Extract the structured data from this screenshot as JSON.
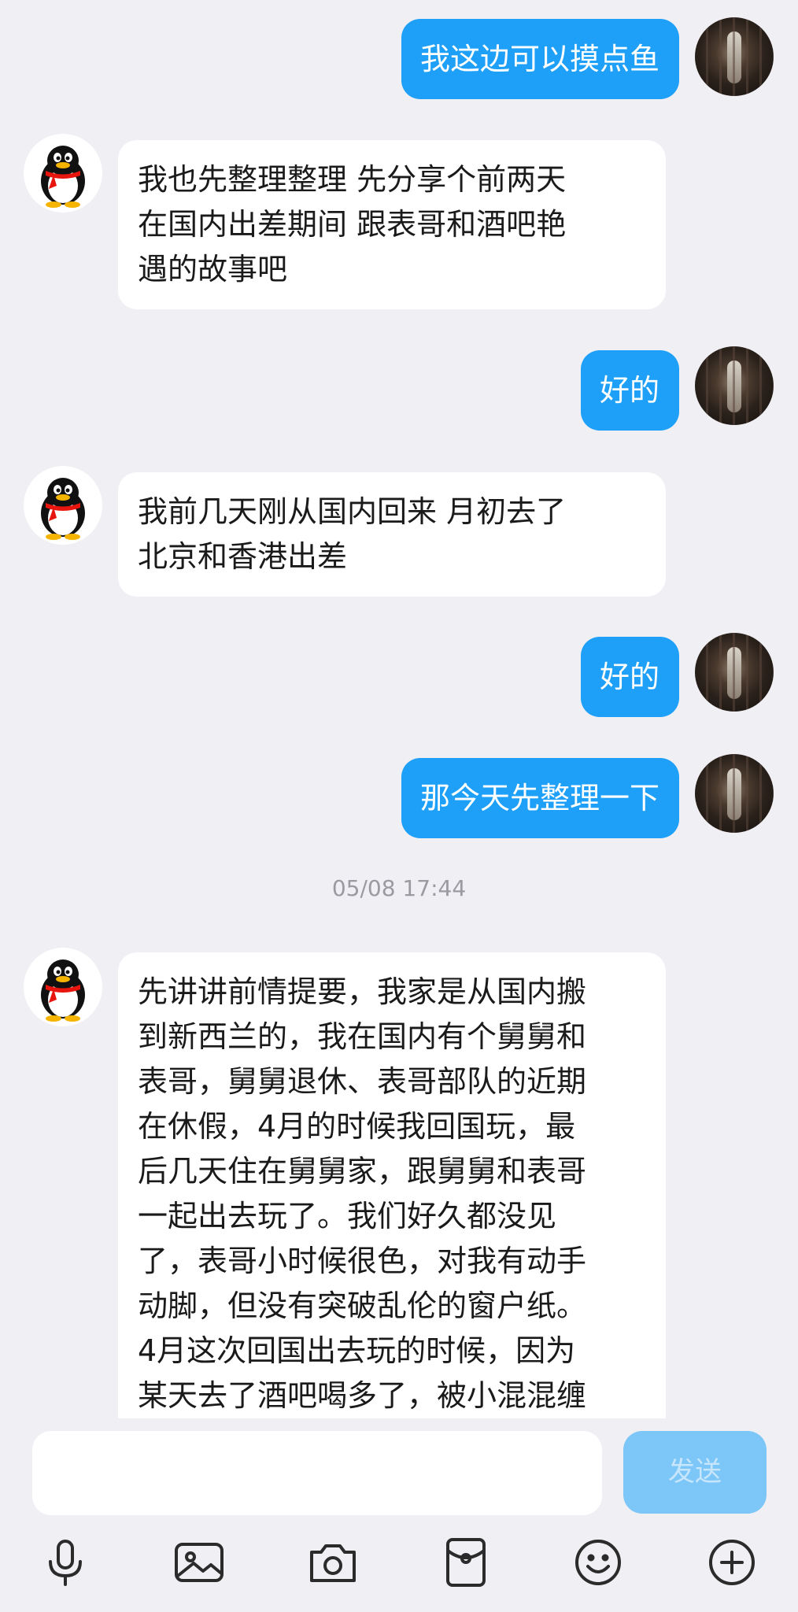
{
  "messages": [
    {
      "side": "me",
      "text": "我这边可以摸点鱼"
    },
    {
      "side": "other",
      "lines": [
        "我也先整理整理 先分享个前两天",
        "在国内出差期间 跟表哥和酒吧艳",
        "遇的故事吧"
      ]
    },
    {
      "side": "me",
      "text": "好的"
    },
    {
      "side": "other",
      "lines": [
        "我前几天刚从国内回来 月初去了",
        "北京和香港出差"
      ]
    },
    {
      "side": "me",
      "text": "好的"
    },
    {
      "side": "me",
      "text": "那今天先整理一下"
    },
    {
      "side": "other",
      "lines": [
        "先讲讲前情提要，我家是从国内搬",
        "到新西兰的，我在国内有个舅舅和",
        "表哥，舅舅退休、表哥部队的近期",
        "在休假，4月的时候我回国玩，最",
        "后几天住在舅舅家，跟舅舅和表哥",
        "一起出去玩了。我们好久都没见",
        "了，表哥小时候很色，对我有动手",
        "动脚，但没有突破乱伦的窗户纸。",
        "4月这次回国出去玩的时候，因为",
        "某天去了酒吧喝多了，被小混混缠"
      ]
    }
  ],
  "timestamp": "05/08 17:44",
  "input": {
    "placeholder": "",
    "send_label": "发送"
  },
  "toolbar": [
    "microphone-icon",
    "image-icon",
    "camera-icon",
    "red-packet-icon",
    "emoji-icon",
    "plus-icon"
  ],
  "colors": {
    "my_bubble": "#1fa0f8",
    "other_bubble": "#ffffff",
    "background": "#efeff4",
    "send_disabled": "#7cc6f8"
  }
}
